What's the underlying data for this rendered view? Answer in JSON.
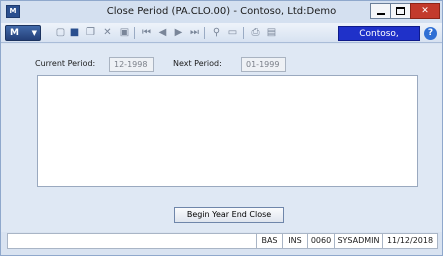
{
  "window": {
    "title": "Close Period (PA.CLO.00) - Contoso, Ltd:Demo",
    "app_icon_label": "M"
  },
  "toolbar": {
    "menu_label": "M",
    "icons": [
      "new-icon",
      "save-icon",
      "copy-icon",
      "delete-icon",
      "finish-icon",
      "first-icon",
      "previous-icon",
      "next-icon",
      "last-icon",
      "attach-icon",
      "paste-icon",
      "print-icon",
      "report-icon"
    ],
    "company_badge": "Contoso, Ltd:Demo",
    "help_label": "?"
  },
  "form": {
    "current_period_label": "Current Period:",
    "current_period_value": "12-1998",
    "next_period_label": "Next Period:",
    "next_period_value": "01-1999",
    "action_button_label": "Begin Year End Close"
  },
  "statusbar": {
    "mode": "BAS",
    "insert": "INS",
    "code": "0060",
    "user": "SYSADMIN",
    "date": "11/12/2018"
  },
  "colors": {
    "window_bg": "#d9e3f1",
    "company_badge_bg": "#1f31c9",
    "close_button_bg": "#c33a2c"
  }
}
